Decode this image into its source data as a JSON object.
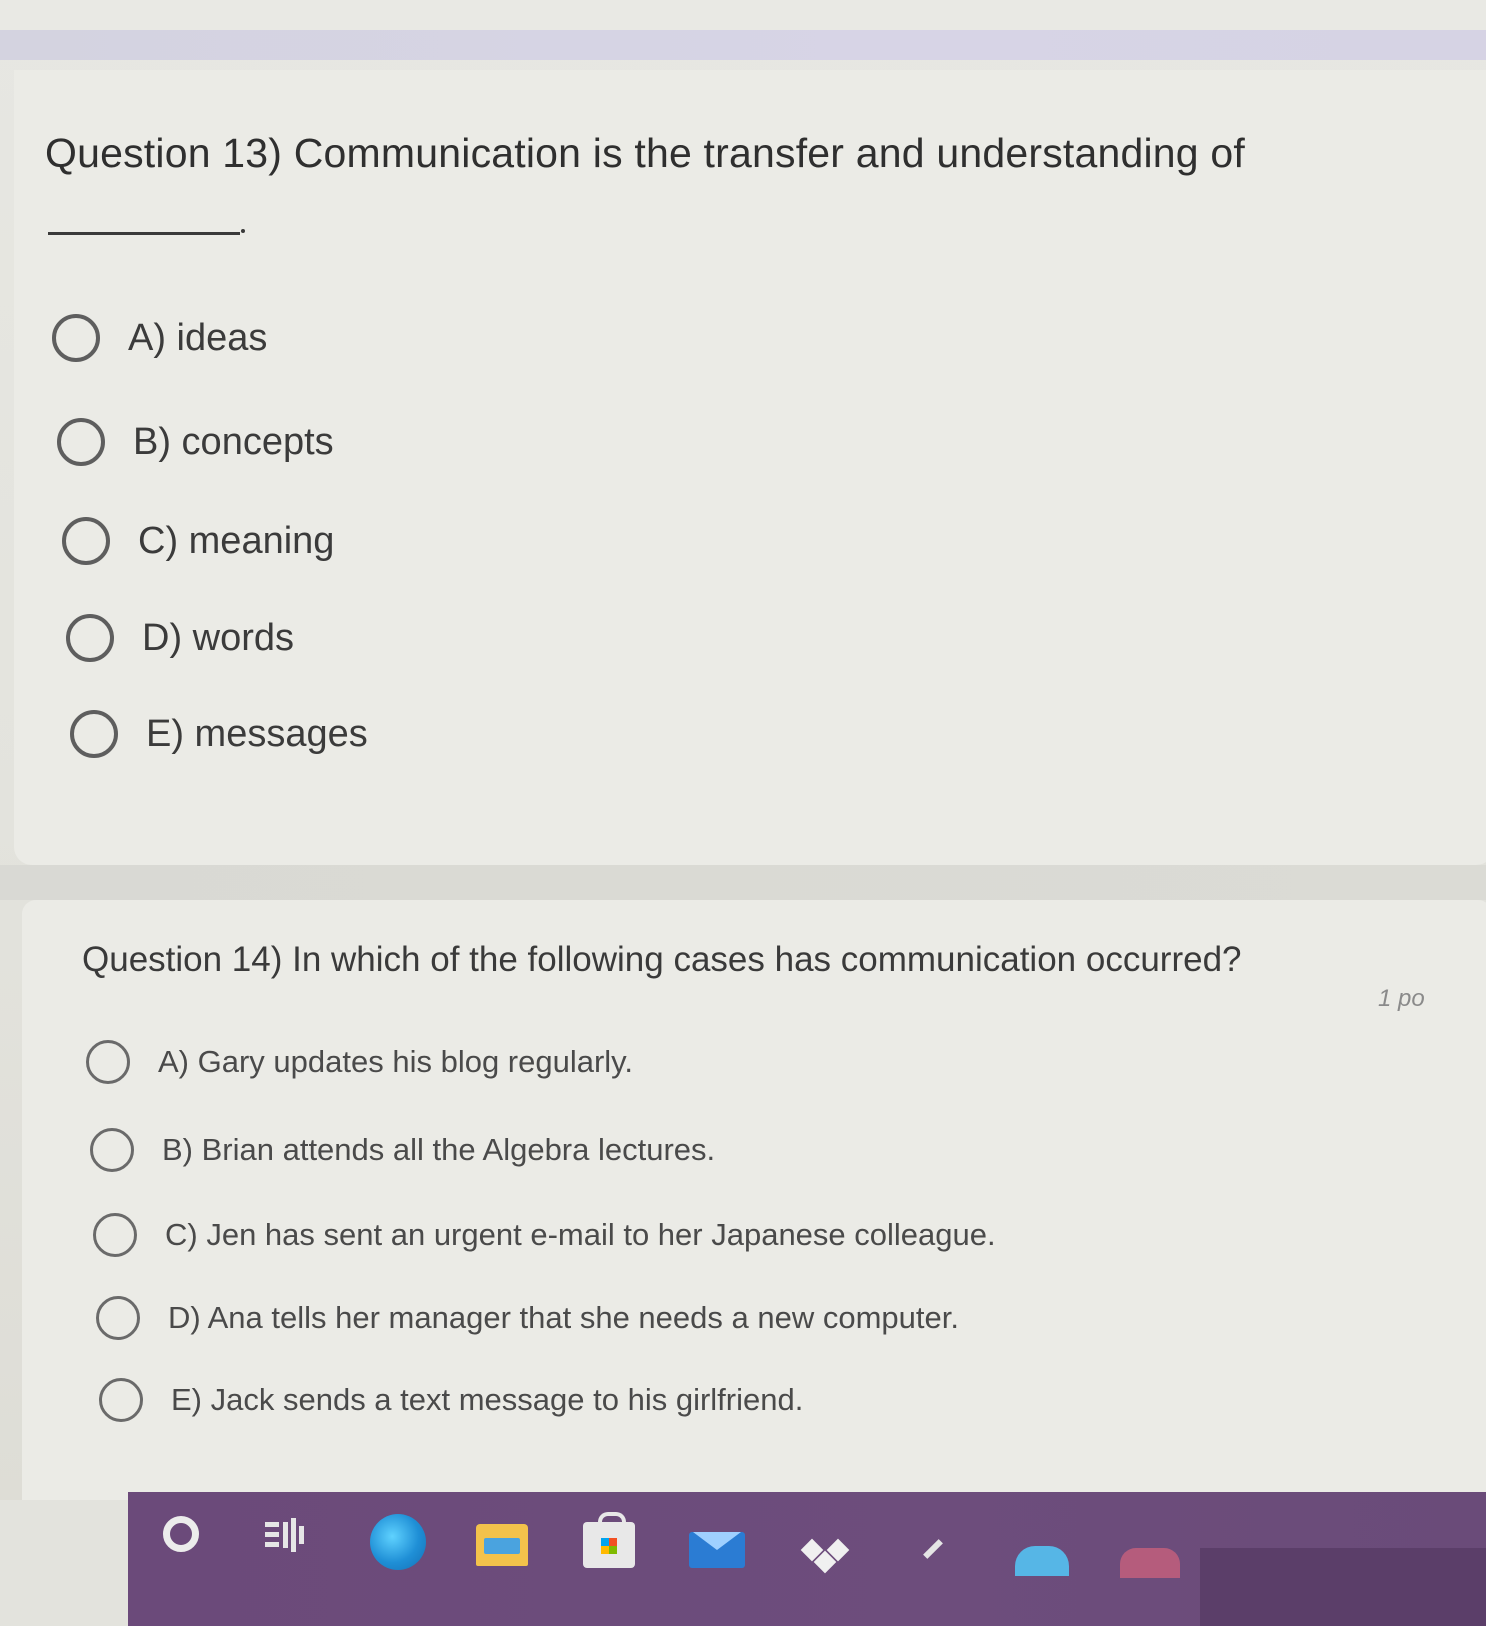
{
  "question13": {
    "title": "Question 13) Communication is the transfer and understanding of",
    "options": [
      "A) ideas",
      "B) concepts",
      "C) meaning",
      "D) words",
      "E) messages"
    ]
  },
  "question14": {
    "title": "Question 14) In which of the following cases has communication occurred?",
    "points": "1 po",
    "options": [
      "A) Gary updates his blog regularly.",
      "B) Brian attends all the Algebra lectures.",
      "C) Jen has sent an urgent e-mail to her Japanese colleague.",
      "D) Ana tells her manager that she needs a new computer.",
      "E) Jack sends a text message to his girlfriend."
    ]
  },
  "taskbar": {
    "icons": [
      "search-icon",
      "task-view-icon",
      "edge-icon",
      "file-explorer-icon",
      "store-icon",
      "mail-icon",
      "dropbox-icon",
      "checkmark-app-icon",
      "cloud-app-icon",
      "active-app-icon"
    ]
  },
  "colors": {
    "accent_bar": "#d6d3e4",
    "taskbar": "#6b4a7a",
    "text": "#2f2f2f",
    "radio_border": "#5e5e5e"
  }
}
